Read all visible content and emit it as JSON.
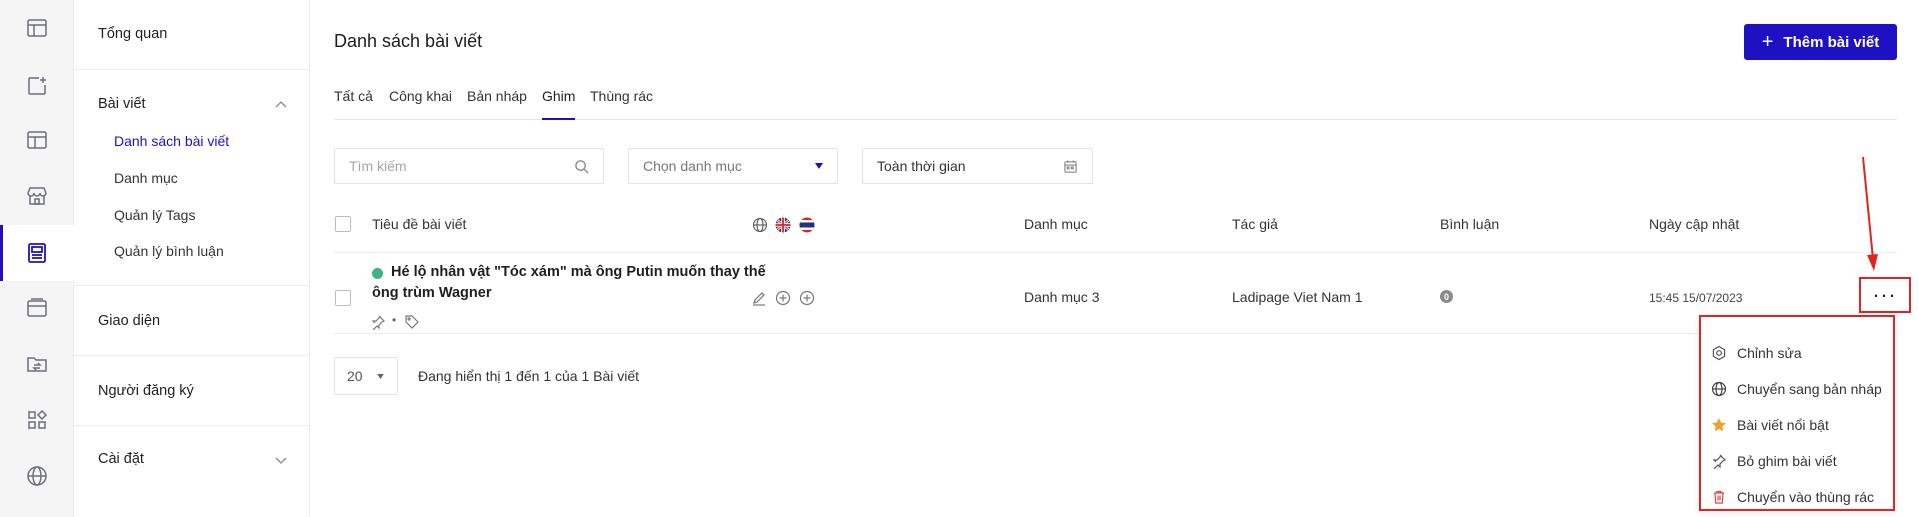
{
  "rail": {
    "items": [
      {
        "icon": "layout-table-icon"
      },
      {
        "icon": "add-page-icon"
      },
      {
        "icon": "template-icon"
      },
      {
        "icon": "store-icon"
      },
      {
        "icon": "article-icon",
        "active": true
      },
      {
        "icon": "browser-window-icon"
      },
      {
        "icon": "folder-sync-icon"
      },
      {
        "icon": "apps-grid-icon"
      },
      {
        "icon": "globe-icon"
      }
    ]
  },
  "nav": {
    "overview": "Tổng quan",
    "posts": {
      "title": "Bài viết",
      "items": [
        "Danh sách bài viết",
        "Danh mục",
        "Quản lý Tags",
        "Quản lý bình luận"
      ]
    },
    "appearance": "Giao diện",
    "subscribers": "Người đăng ký",
    "settings": "Cài đặt"
  },
  "header": {
    "title": "Danh sách bài viết",
    "add_button": "Thêm bài viết"
  },
  "tabs": [
    "Tất cả",
    "Công khai",
    "Bản nháp",
    "Ghim",
    "Thùng rác"
  ],
  "active_tab": "Ghim",
  "filters": {
    "search_placeholder": "Tìm kiếm",
    "category_placeholder": "Chọn danh mục",
    "date_value": "Toàn thời gian"
  },
  "table": {
    "columns": {
      "title": "Tiêu đề bài viết",
      "category": "Danh mục",
      "author": "Tác giả",
      "comments": "Bình luận",
      "updated": "Ngày cập nhật"
    },
    "language_flags": [
      "globe-icon",
      "uk-flag-icon",
      "thai-flag-icon"
    ],
    "rows": [
      {
        "title_line1": "Hé lộ nhân vật \"Tóc xám\" mà ông Putin muốn thay thế",
        "title_line2": "ông trùm Wagner",
        "category": "Danh mục 3",
        "author": "Ladipage Viet Nam 1",
        "comments": "0",
        "updated": "15:45 15/07/2023",
        "meta_separator": "•"
      }
    ]
  },
  "more_button": "...",
  "context_menu": [
    {
      "label": "Chỉnh sửa",
      "icon": "gear-icon"
    },
    {
      "label": "Chuyển sang bản nháp",
      "icon": "globe-icon"
    },
    {
      "label": "Bài viết nổi bật",
      "icon": "star-icon"
    },
    {
      "label": "Bỏ ghim bài viết",
      "icon": "pin-icon"
    },
    {
      "label": "Chuyển vào thùng rác",
      "icon": "trash-icon"
    }
  ],
  "pagination": {
    "page_size": "20",
    "summary": "Đang hiển thị 1 đến 1 của 1 Bài viết"
  },
  "colors": {
    "accent": "#2010c4",
    "annotation_red": "#e02424",
    "status_green": "#3fb380",
    "star_orange": "#f0a030",
    "trash_red": "#e0443c"
  }
}
